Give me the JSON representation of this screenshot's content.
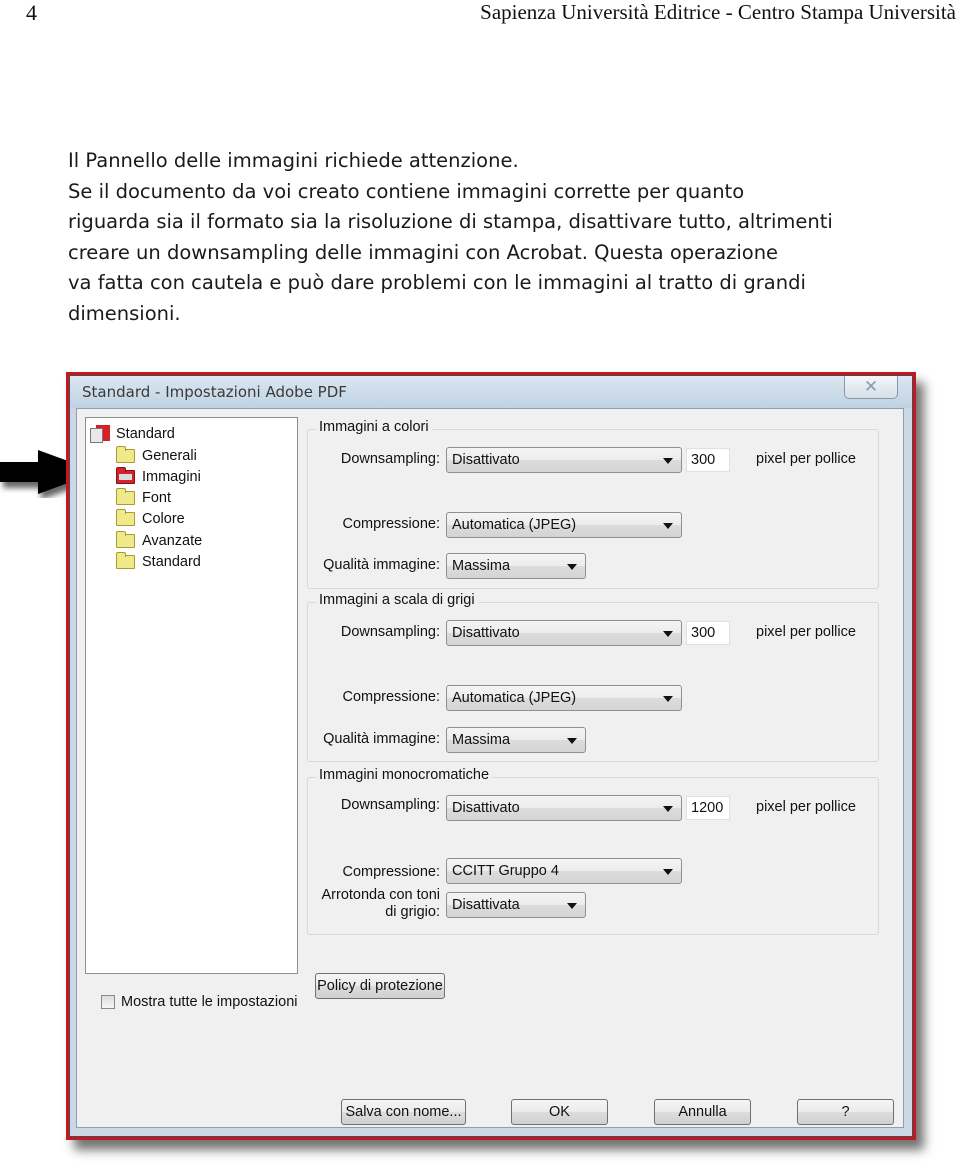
{
  "header": {
    "page_number": "4",
    "running_head": "Sapienza Università Editrice - Centro Stampa Università"
  },
  "body": {
    "lines": [
      "Il Pannello delle immagini richiede attenzione.",
      "Se il documento da voi creato contiene immagini corrette per quanto",
      "riguarda sia il formato sia la risoluzione di stampa, disattivare tutto, altrimenti",
      "creare un downsampling delle immagini con Acrobat. Questa operazione",
      "va fatta con cautela e può dare problemi con le immagini al tratto di grandi",
      "dimensioni."
    ]
  },
  "annotation": {
    "arrow_icon": "right-arrow-icon",
    "frame_color": "#c8161d"
  },
  "dialog": {
    "title": "Standard - Impostazioni Adobe PDF",
    "close_glyph": "✕",
    "tree": {
      "items": [
        {
          "label": "Standard",
          "icon": "pdf-settings-icon",
          "level": 0
        },
        {
          "label": "Generali",
          "icon": "folder-icon",
          "level": 1
        },
        {
          "label": "Immagini",
          "icon": "folder-open-icon",
          "level": 1,
          "selected": true
        },
        {
          "label": "Font",
          "icon": "folder-icon",
          "level": 1
        },
        {
          "label": "Colore",
          "icon": "folder-icon",
          "level": 1
        },
        {
          "label": "Avanzate",
          "icon": "folder-icon",
          "level": 1
        },
        {
          "label": "Standard",
          "icon": "folder-icon",
          "level": 1
        }
      ]
    },
    "groups": [
      {
        "title": "Immagini a colori",
        "downsampling_label": "Downsampling:",
        "downsampling_value": "Disattivato",
        "resolution": "300",
        "unit": "pixel per pollice",
        "compression_label": "Compressione:",
        "compression_value": "Automatica (JPEG)",
        "quality_label": "Qualità immagine:",
        "quality_value": "Massima"
      },
      {
        "title": "Immagini a scala di grigi",
        "downsampling_label": "Downsampling:",
        "downsampling_value": "Disattivato",
        "resolution": "300",
        "unit": "pixel per pollice",
        "compression_label": "Compressione:",
        "compression_value": "Automatica (JPEG)",
        "quality_label": "Qualità immagine:",
        "quality_value": "Massima"
      },
      {
        "title": "Immagini monocromatiche",
        "downsampling_label": "Downsampling:",
        "downsampling_value": "Disattivato",
        "resolution": "1200",
        "unit": "pixel per pollice",
        "compression_label": "Compressione:",
        "compression_value": "CCITT Gruppo 4",
        "antialias_label_1": "Arrotonda con toni",
        "antialias_label_2": "di grigio:",
        "antialias_value": "Disattivata"
      }
    ],
    "show_all_checkbox": {
      "label": "Mostra tutte le impostazioni",
      "checked": false
    },
    "security_policy_button": "Policy di protezione",
    "buttons": {
      "save_as": "Salva con nome...",
      "ok": "OK",
      "cancel": "Annulla",
      "help": "?"
    }
  }
}
